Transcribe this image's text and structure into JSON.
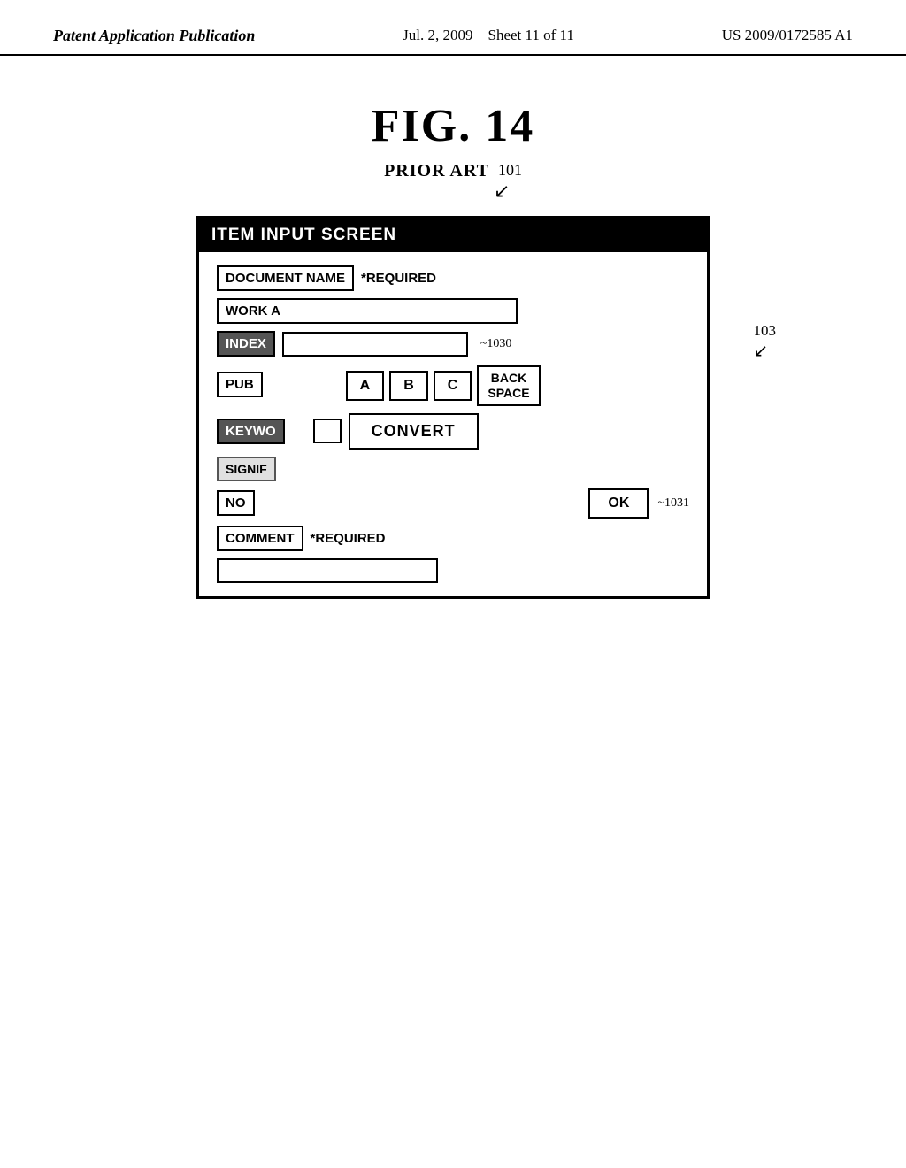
{
  "header": {
    "left": "Patent Application Publication",
    "center_date": "Jul. 2, 2009",
    "center_sheet": "Sheet 11 of 11",
    "right": "US 2009/0172585 A1"
  },
  "figure": {
    "title": "FIG. 14",
    "prior_art": "PRIOR ART",
    "ref_101": "101"
  },
  "dialog": {
    "title": "ITEM INPUT SCREEN",
    "ref_103": "103",
    "doc_name_label": "DOCUMENT NAME",
    "required_label": "*REQUIRED",
    "work_value": "WORK A",
    "index_label": "INDEX",
    "index_ref": "~1030",
    "pub_label": "PUB",
    "keyword_label": "KEYWO",
    "key_a": "A",
    "key_b": "B",
    "key_c": "C",
    "backspace_label": "BACK\nSPACE",
    "convert_label": "CONVERT",
    "signif_label": "SIGNIF",
    "no_label": "NO",
    "ok_label": "OK",
    "ok_ref": "~1031",
    "comment_label": "COMMENT",
    "comment_required": "*REQUIRED"
  }
}
